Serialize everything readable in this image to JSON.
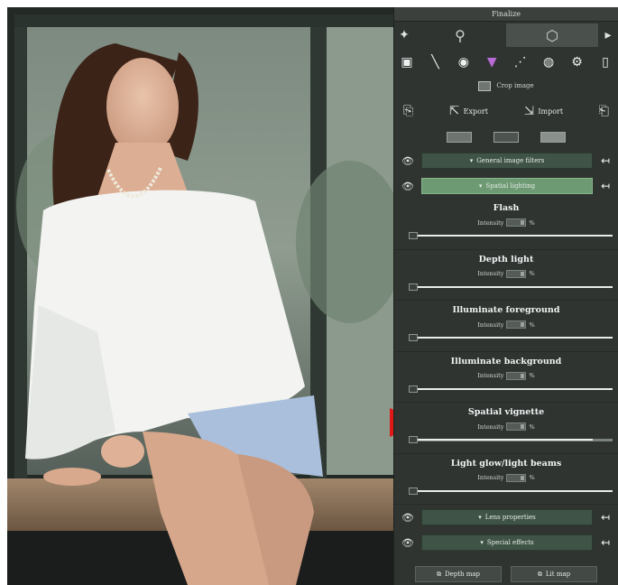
{
  "panel": {
    "title": "Finalize",
    "tabs": [
      {
        "icon": "magnifier-icon",
        "glyph": "⚲",
        "active": false
      },
      {
        "icon": "cube-icon",
        "glyph": "⬡",
        "active": true
      }
    ],
    "side_left_glyph": "✦",
    "side_right_glyph": "▸",
    "tools": [
      {
        "icon": "image-icon",
        "glyph": "▣"
      },
      {
        "icon": "brush-icon",
        "glyph": "╲"
      },
      {
        "icon": "color-wheel-icon",
        "glyph": "◉"
      },
      {
        "icon": "rgb-icon",
        "glyph": "▼"
      },
      {
        "icon": "nodes-icon",
        "glyph": "⋰"
      },
      {
        "icon": "texture-icon",
        "glyph": "◍"
      },
      {
        "icon": "gear-icon",
        "glyph": "⚙"
      },
      {
        "icon": "document-icon",
        "glyph": "▯"
      }
    ],
    "crop_label": "Crop image",
    "export_label": "Export",
    "import_label": "Import",
    "sections": {
      "general": "General image filters",
      "spatial_lighting": "Spatial lighting",
      "lens": "Lens properties",
      "special": "Special effects"
    },
    "effects": [
      {
        "name": "Flash",
        "intensity_label": "Intensity",
        "unit": "%",
        "level": 1.0
      },
      {
        "name": "Depth light",
        "intensity_label": "Intensity",
        "unit": "%",
        "level": 1.0
      },
      {
        "name": "Illuminate foreground",
        "intensity_label": "Intensity",
        "unit": "%",
        "level": 1.0
      },
      {
        "name": "Illuminate background",
        "intensity_label": "Intensity",
        "unit": "%",
        "level": 1.0
      },
      {
        "name": "Spatial vignette",
        "intensity_label": "Intensity",
        "unit": "%",
        "level": 0.9
      },
      {
        "name": "Light glow/light beams",
        "intensity_label": "Intensity",
        "unit": "%",
        "level": 1.0
      }
    ],
    "depth_map_label": "Depth map",
    "lit_map_label": "Lit map"
  },
  "colors": {
    "accent_active": "#6d9a72",
    "section_bg": "#3f5446",
    "arrow": "#e01818"
  }
}
